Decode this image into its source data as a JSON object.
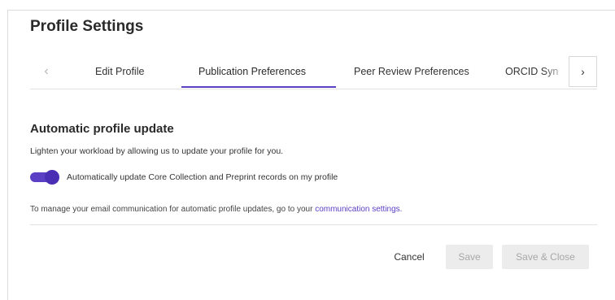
{
  "page": {
    "title": "Profile Settings"
  },
  "tabs": {
    "prev_icon": "chevron-left-icon",
    "next_icon": "chevron-right-icon",
    "items": [
      {
        "label": "Edit Profile"
      },
      {
        "label": "Publication Preferences"
      },
      {
        "label": "Peer Review Preferences"
      },
      {
        "label": "ORCID Syn"
      }
    ],
    "active_index": 1
  },
  "auto_update": {
    "title": "Automatic profile update",
    "description": "Lighten your workload by allowing us to update your profile for you.",
    "toggle_label": "Automatically update Core Collection and Preprint records on my profile",
    "toggle_on": true,
    "manage_text": "To manage your email communication for automatic profile updates, go to your",
    "manage_link": "communication settings."
  },
  "actions": {
    "cancel": "Cancel",
    "save": "Save",
    "save_close": "Save & Close"
  },
  "colors": {
    "accent": "#5b3fc4",
    "disabled_bg": "#ececec",
    "disabled_text": "#a8a8a8"
  }
}
